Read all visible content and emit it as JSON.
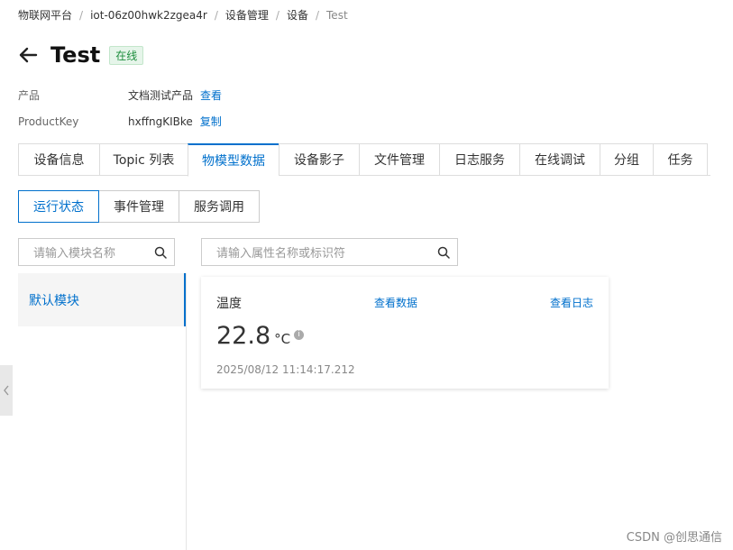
{
  "breadcrumb": {
    "items": [
      "物联网平台",
      "iot-06z00hwk2zgea4r",
      "设备管理",
      "设备"
    ],
    "current": "Test",
    "separator": "/"
  },
  "header": {
    "title": "Test",
    "status": "在线"
  },
  "info": {
    "product_label": "产品",
    "product_value": "文档测试产品",
    "product_link": "查看",
    "productkey_label": "ProductKey",
    "productkey_value": "hxffngKIBke",
    "productkey_link": "复制"
  },
  "tabs": [
    {
      "label": "设备信息",
      "active": false
    },
    {
      "label": "Topic 列表",
      "active": false
    },
    {
      "label": "物模型数据",
      "active": true
    },
    {
      "label": "设备影子",
      "active": false
    },
    {
      "label": "文件管理",
      "active": false
    },
    {
      "label": "日志服务",
      "active": false
    },
    {
      "label": "在线调试",
      "active": false
    },
    {
      "label": "分组",
      "active": false
    },
    {
      "label": "任务",
      "active": false
    }
  ],
  "subtabs": [
    {
      "label": "运行状态",
      "active": true
    },
    {
      "label": "事件管理",
      "active": false
    },
    {
      "label": "服务调用",
      "active": false
    }
  ],
  "module_search": {
    "placeholder": "请输入模块名称"
  },
  "modules": [
    {
      "label": "默认模块",
      "active": true
    }
  ],
  "property_search": {
    "placeholder": "请输入属性名称或标识符"
  },
  "property_card": {
    "name": "温度",
    "view_data_link": "查看数据",
    "view_log_link": "查看日志",
    "value": "22.8",
    "unit": "°C",
    "timestamp": "2025/08/12 11:14:17.212"
  },
  "watermark": "CSDN @创思通信",
  "colors": {
    "accent": "#0070cc",
    "status_green": "#1e8e3e"
  }
}
